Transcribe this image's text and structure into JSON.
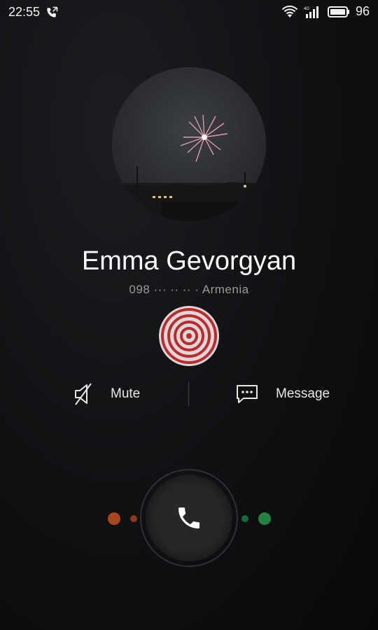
{
  "status_bar": {
    "time": "22:55",
    "battery_percent": "96",
    "icons": [
      "call-forwarding-icon",
      "wifi-icon",
      "signal-icon",
      "battery-icon"
    ]
  },
  "caller": {
    "name": "Emma Gevorgyan",
    "number": "098 ··· ·· ·· · Armenia",
    "avatar": "fireworks-photo"
  },
  "actions": {
    "mute_label": "Mute",
    "message_label": "Message"
  },
  "answer": {
    "decline_color": "#a8461c",
    "accept_color": "#23823f"
  },
  "colors": {
    "record_indicator": "#c0282c"
  }
}
